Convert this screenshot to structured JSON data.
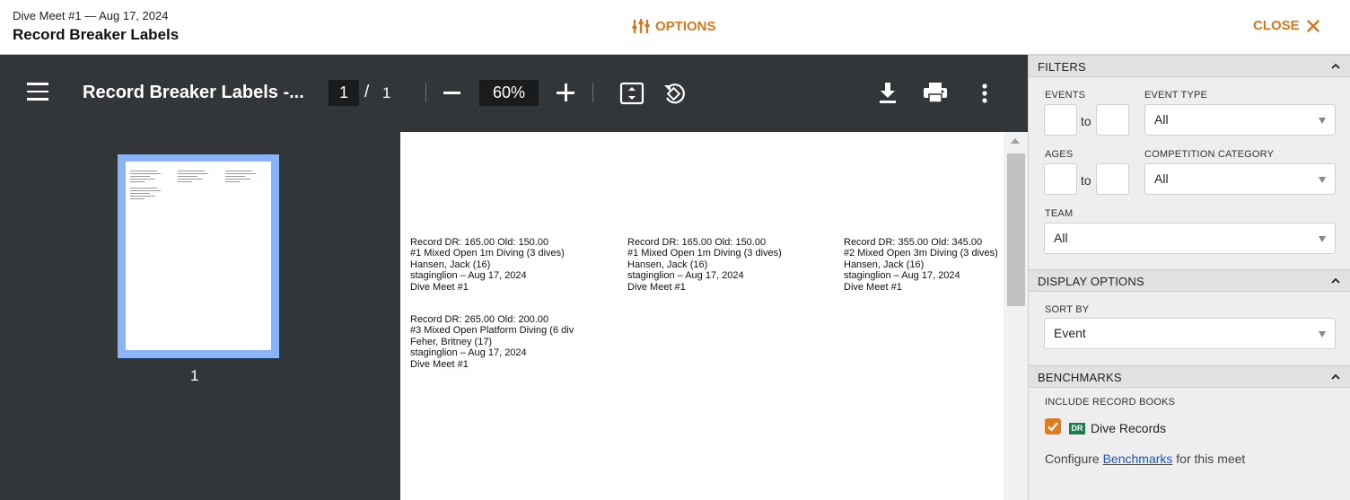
{
  "header": {
    "meet_subtitle": "Dive Meet #1 — Aug 17, 2024",
    "title": "Record Breaker Labels",
    "options_label": "OPTIONS",
    "close_label": "CLOSE",
    "accent_color": "#d9771f"
  },
  "pdf_toolbar": {
    "doc_title": "Record Breaker Labels -...",
    "current_page": "1",
    "page_separator": "/",
    "total_pages": "1",
    "zoom": "60%",
    "icons": [
      "menu-icon",
      "zoom-out-icon",
      "zoom-in-icon",
      "fit-page-icon",
      "rotate-icon",
      "download-icon",
      "print-icon",
      "more-vert-icon"
    ]
  },
  "thumbnails": {
    "page_number": "1"
  },
  "document": {
    "labels": [
      {
        "line1": "Record DR: 165.00 Old: 150.00",
        "line2": "#1 Mixed Open 1m Diving (3 dives)",
        "line3": "Hansen, Jack (16)",
        "line4": "staginglion – Aug 17, 2024",
        "line5": "Dive Meet #1"
      },
      {
        "line1": "Record DR: 165.00 Old: 150.00",
        "line2": "#1 Mixed Open 1m Diving (3 dives)",
        "line3": "Hansen, Jack (16)",
        "line4": "staginglion – Aug 17, 2024",
        "line5": "Dive Meet #1"
      },
      {
        "line1": "Record DR: 355.00 Old: 345.00",
        "line2": "#2 Mixed Open 3m Diving (3 dives)",
        "line3": "Hansen, Jack (16)",
        "line4": "staginglion – Aug 17, 2024",
        "line5": "Dive Meet #1"
      },
      {
        "line1": "Record DR: 265.00 Old: 200.00",
        "line2": "#3 Mixed Open Platform Diving (6 div",
        "line3": "Feher, Britney (17)",
        "line4": "staginglion – Aug 17, 2024",
        "line5": "Dive Meet #1"
      }
    ]
  },
  "panel": {
    "filters": {
      "heading": "FILTERS",
      "events_label": "EVENTS",
      "events_from": "",
      "events_to": "",
      "to_word": "to",
      "event_type_label": "EVENT TYPE",
      "event_type_value": "All",
      "ages_label": "AGES",
      "ages_from": "",
      "ages_to": "",
      "competition_category_label": "COMPETITION CATEGORY",
      "competition_category_value": "All",
      "team_label": "TEAM",
      "team_value": "All"
    },
    "display_options": {
      "heading": "DISPLAY OPTIONS",
      "sort_by_label": "SORT BY",
      "sort_by_value": "Event"
    },
    "benchmarks": {
      "heading": "BENCHMARKS",
      "include_label": "INCLUDE RECORD BOOKS",
      "badge": "DR",
      "record_book_name": "Dive Records",
      "record_book_checked": true,
      "configure_prefix": "Configure ",
      "configure_link": "Benchmarks",
      "configure_suffix": " for this meet"
    }
  }
}
